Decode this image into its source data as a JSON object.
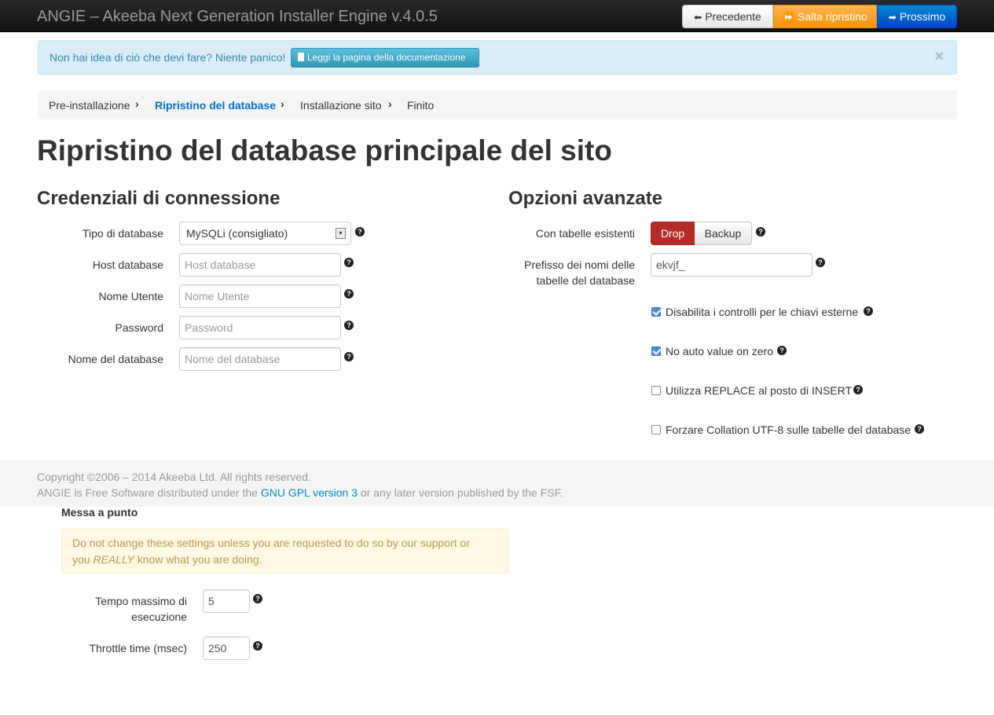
{
  "navbar": {
    "brand": "ANGIE – Akeeba Next Generation Installer Engine v.4.0.5",
    "prev_label": "Precedente",
    "skip_label": "Salta ripristino",
    "next_label": "Prossimo"
  },
  "info_alert": {
    "message": "Non hai idea di ciò che devi fare? Niente panico!",
    "button_label": "Leggi la pagina della documentazione",
    "close": "×"
  },
  "breadcrumb": {
    "items": [
      "Pre-installazione",
      "Ripristino del database",
      "Installazione sito",
      "Finito"
    ],
    "active_index": 1
  },
  "page_title": "Ripristino del database principale del sito",
  "connection": {
    "title": "Credenziali di connessione",
    "db_type_label": "Tipo di database",
    "db_type_value": "MySQLi (consigliato)",
    "host_label": "Host database",
    "host_placeholder": "Host database",
    "user_label": "Nome Utente",
    "user_placeholder": "Nome Utente",
    "password_label": "Password",
    "password_placeholder": "Password",
    "dbname_label": "Nome del database",
    "dbname_placeholder": "Nome del database"
  },
  "advanced": {
    "title": "Opzioni avanzate",
    "existing_label": "Con tabelle esistenti",
    "drop_label": "Drop",
    "backup_label": "Backup",
    "prefix_label_1": "Prefisso dei nomi delle",
    "prefix_label_2": "tabelle del database",
    "prefix_value": "ekvjf_",
    "checkboxes": [
      {
        "label": "Disabilita i controlli per le chiavi esterne",
        "checked": true
      },
      {
        "label": "No auto value on zero",
        "checked": true
      },
      {
        "label": "Utilizza REPLACE al posto di INSERT",
        "checked": false
      },
      {
        "label": "Forzare Collation UTF-8 sulle tabelle del database",
        "checked": false
      }
    ]
  },
  "footer": {
    "copyright": "Copyright ©2006 – 2014 Akeeba Ltd. All rights reserved.",
    "license_prefix": "ANGIE is Free Software distributed under the",
    "license_link": "GNU GPL version 3",
    "license_suffix": "or any later version published by the FSF."
  },
  "tuning": {
    "title": "Messa a punto",
    "warning_1": "Do not change these settings unless you are requested to do so by our support or",
    "warning_2a": "you",
    "warning_2b": "REALLY",
    "warning_2c": "know what you are doing.",
    "max_exec_label_1": "Tempo massimo di",
    "max_exec_label_2": "esecuzione",
    "max_exec_value": "5",
    "throttle_label": "Throttle time (msec)",
    "throttle_value": "250"
  },
  "icons": {
    "prev": "arrow-left-icon",
    "skip": "fast-forward-icon",
    "next": "arrow-right-icon",
    "help": "question-circle-icon"
  },
  "colors": {
    "navbar": "#1b1b1b",
    "primary": "#0044cc",
    "warning": "#f89406",
    "danger": "#b52b27",
    "link": "#0088cc"
  }
}
